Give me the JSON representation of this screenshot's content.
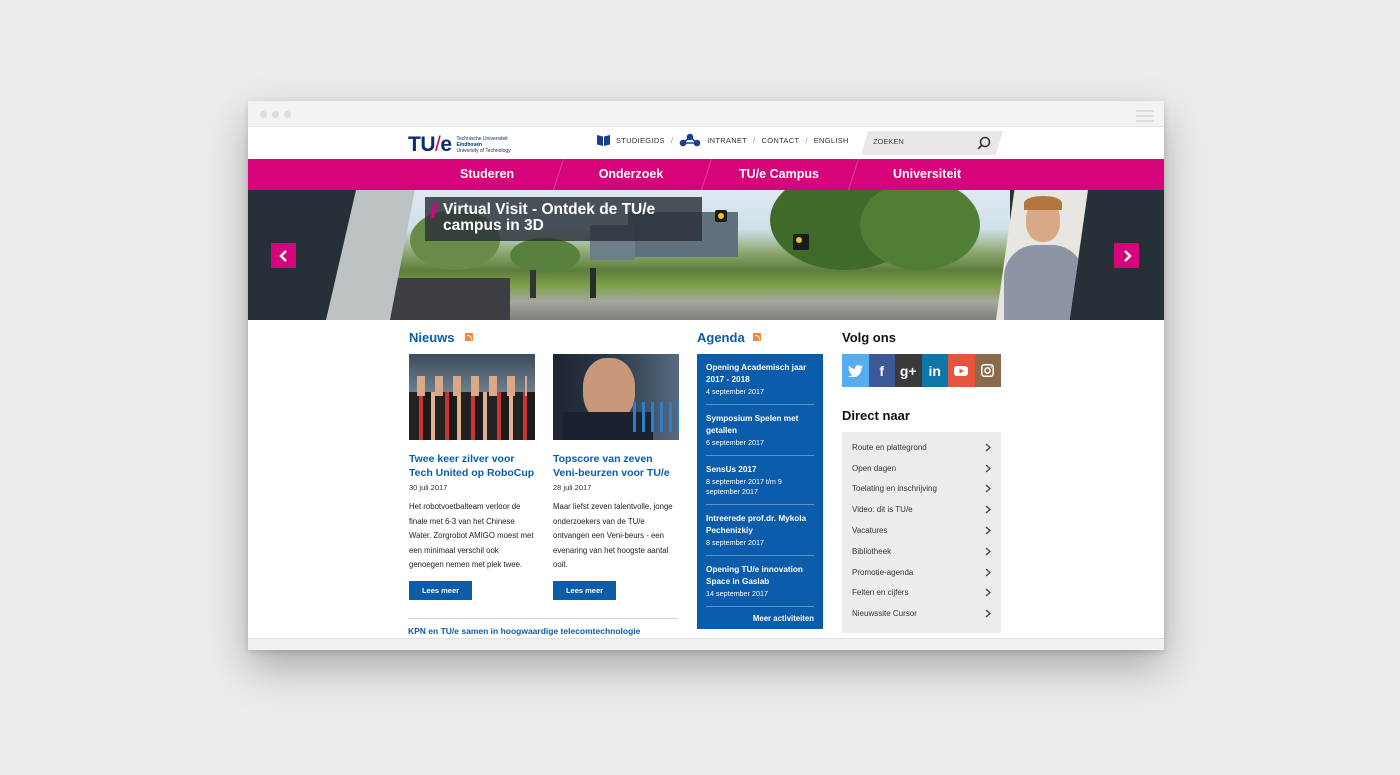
{
  "logo": {
    "mark_left": "TU",
    "mark_slash": "/",
    "mark_right": "e",
    "line1": "Technische Universiteit",
    "line2": "Eindhoven",
    "line3": "University of Technology"
  },
  "utility_nav": {
    "studiegids": "STUDIEGIDS",
    "intranet": "INTRANET",
    "contact": "CONTACT",
    "english": "ENGLISH",
    "separator": "/"
  },
  "search": {
    "placeholder": "ZOEKEN"
  },
  "main_nav": {
    "items": [
      {
        "label": "Studeren"
      },
      {
        "label": "Onderzoek"
      },
      {
        "label": "TU/e Campus"
      },
      {
        "label": "Universiteit"
      }
    ]
  },
  "hero": {
    "title": "Virtual Visit - Ontdek de TU/e campus in 3D"
  },
  "news": {
    "heading": "Nieuws",
    "items": [
      {
        "title": "Twee keer zilver voor Tech United op RoboCup",
        "date": "30 juli 2017",
        "description": "Het robotvoetbalteam verloor de finale met 6-3 van het Chinese Water. Zorgrobot AMIGO moest met een minimaal verschil ook genoegen nemen met plek twee.",
        "button": "Lees meer"
      },
      {
        "title": "Topscore van zeven Veni-beurzen voor TU/e",
        "date": "28 juli 2017",
        "description": "Maar liefst zeven talentvolle, jonge onderzoekers van de TU/e ontvangen een Veni-beurs - een evenaring van het hoogste aantal ooit.",
        "button": "Lees meer"
      }
    ],
    "headline": "KPN en TU/e samen in hoogwaardige telecomtechnologie"
  },
  "agenda": {
    "heading": "Agenda",
    "items": [
      {
        "title": "Opening Academisch jaar 2017 - 2018",
        "date": "4 september 2017"
      },
      {
        "title": "Symposium Spelen met getallen",
        "date": "6 september 2017"
      },
      {
        "title": "SensUs 2017",
        "date": "8 september 2017 t/m 9 september 2017"
      },
      {
        "title": "Intreerede prof.dr. Mykola Pechenizkiy",
        "date": "8 september 2017"
      },
      {
        "title": "Opening TU/e innovation Space in Gaslab",
        "date": "14 september 2017"
      }
    ],
    "more": "Meer activiteiten"
  },
  "follow": {
    "heading": "Volg ons",
    "networks": [
      {
        "name": "twitter-icon",
        "glyph": "",
        "color": "#55acee"
      },
      {
        "name": "facebook-icon",
        "glyph": "f",
        "color": "#3b5998"
      },
      {
        "name": "google-plus-icon",
        "glyph": "g+",
        "color": "#3a3a3a"
      },
      {
        "name": "linkedin-icon",
        "glyph": "in",
        "color": "#0e76a8"
      },
      {
        "name": "youtube-icon",
        "glyph": "",
        "color": "#e5553b"
      },
      {
        "name": "instagram-icon",
        "glyph": "",
        "color": "#8a6a4a"
      }
    ]
  },
  "direct": {
    "heading": "Direct naar",
    "items": [
      "Route en plattegrond",
      "Open dagen",
      "Toelating en inschrijving",
      "Video: dit is TU/e",
      "Vacatures",
      "Bibliotheek",
      "Promotie-agenda",
      "Feiten en cijfers",
      "Nieuwssite Cursor"
    ]
  },
  "colors": {
    "magenta": "#d6037a",
    "blue": "#0b5cab",
    "dark": "#263137"
  }
}
